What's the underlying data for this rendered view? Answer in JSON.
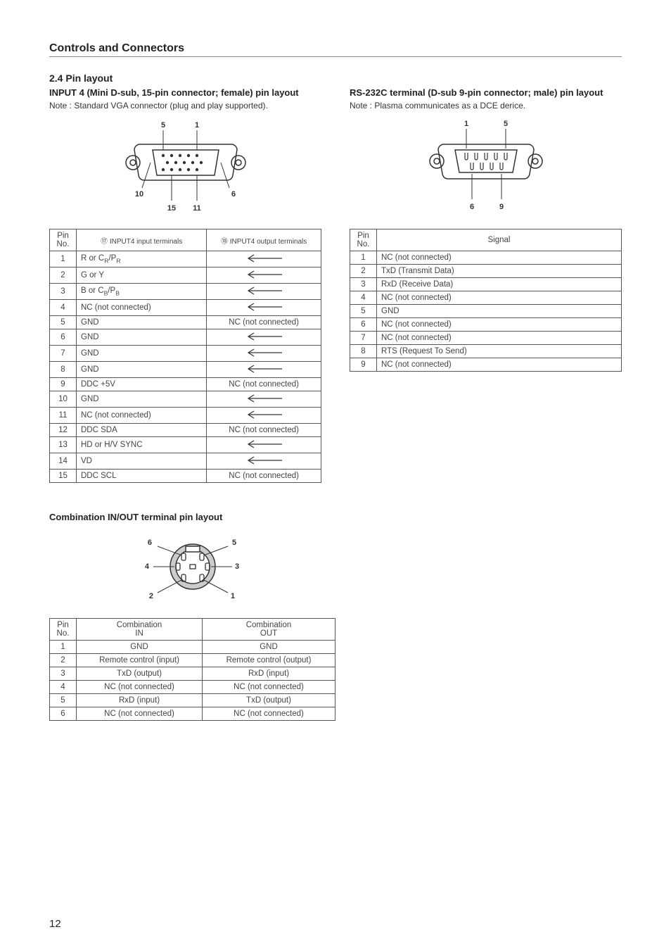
{
  "page_number": "12",
  "section_header": "Controls and Connectors",
  "subsection_title": "2.4 Pin layout",
  "left": {
    "heading": "INPUT 4 (Mini D-sub, 15-pin connector; female) pin layout",
    "note": "Note : Standard VGA connector (plug and play supported).",
    "fig_labels": {
      "a": "5",
      "b": "1",
      "c": "10",
      "d": "6",
      "e": "15",
      "f": "11"
    },
    "table_headers": {
      "pin": "Pin No.",
      "in": "⑰ INPUT4 input terminals",
      "out": "⑱ INPUT4 output terminals"
    },
    "rows": [
      {
        "pin": "1",
        "in_pre": "R or C",
        "in_sub": "R",
        "in_post": "/P",
        "in_sub2": "R",
        "out_type": "arrow"
      },
      {
        "pin": "2",
        "in": "G or Y",
        "out_type": "arrow"
      },
      {
        "pin": "3",
        "in_pre": "B or C",
        "in_sub": "B",
        "in_post": "/P",
        "in_sub2": "B",
        "out_type": "arrow"
      },
      {
        "pin": "4",
        "in": "NC (not connected)",
        "out_type": "arrow"
      },
      {
        "pin": "5",
        "in": "GND",
        "out": "NC (not connected)"
      },
      {
        "pin": "6",
        "in": "GND",
        "out_type": "arrow"
      },
      {
        "pin": "7",
        "in": "GND",
        "out_type": "arrow"
      },
      {
        "pin": "8",
        "in": "GND",
        "out_type": "arrow"
      },
      {
        "pin": "9",
        "in": "DDC +5V",
        "out": "NC (not connected)"
      },
      {
        "pin": "10",
        "in": "GND",
        "out_type": "arrow"
      },
      {
        "pin": "11",
        "in": "NC (not connected)",
        "out_type": "arrow"
      },
      {
        "pin": "12",
        "in": "DDC SDA",
        "out": "NC (not connected)"
      },
      {
        "pin": "13",
        "in": "HD or H/V SYNC",
        "out_type": "arrow"
      },
      {
        "pin": "14",
        "in": "VD",
        "out_type": "arrow"
      },
      {
        "pin": "15",
        "in": "DDC SCL",
        "out": "NC (not connected)"
      }
    ]
  },
  "right": {
    "heading": "RS-232C terminal (D-sub 9-pin connector; male) pin layout",
    "note": "Note : Plasma communicates as a DCE derice.",
    "fig_labels": {
      "a": "1",
      "b": "5",
      "c": "6",
      "d": "9"
    },
    "table_headers": {
      "pin": "Pin No.",
      "sig": "Signal"
    },
    "rows": [
      {
        "pin": "1",
        "sig": "NC (not connected)"
      },
      {
        "pin": "2",
        "sig": "TxD (Transmit Data)"
      },
      {
        "pin": "3",
        "sig": "RxD (Receive Data)"
      },
      {
        "pin": "4",
        "sig": "NC (not connected)"
      },
      {
        "pin": "5",
        "sig": "GND"
      },
      {
        "pin": "6",
        "sig": "NC (not connected)"
      },
      {
        "pin": "7",
        "sig": "NC (not connected)"
      },
      {
        "pin": "8",
        "sig": "RTS (Request To Send)"
      },
      {
        "pin": "9",
        "sig": "NC (not connected)"
      }
    ]
  },
  "comb": {
    "heading": "Combination IN/OUT terminal pin layout",
    "fig_labels": {
      "a": "6",
      "b": "5",
      "c": "4",
      "d": "3",
      "e": "2",
      "f": "1"
    },
    "table_headers": {
      "pin": "Pin No.",
      "in": "Combination IN",
      "out": "Combination OUT"
    },
    "rows": [
      {
        "pin": "1",
        "in": "GND",
        "out": "GND"
      },
      {
        "pin": "2",
        "in": "Remote control (input)",
        "out": "Remote control (output)"
      },
      {
        "pin": "3",
        "in": "TxD (output)",
        "out": "RxD (input)"
      },
      {
        "pin": "4",
        "in": "NC (not connected)",
        "out": "NC (not connected)"
      },
      {
        "pin": "5",
        "in": "RxD (input)",
        "out": "TxD (output)"
      },
      {
        "pin": "6",
        "in": "NC (not connected)",
        "out": "NC (not connected)"
      }
    ]
  }
}
